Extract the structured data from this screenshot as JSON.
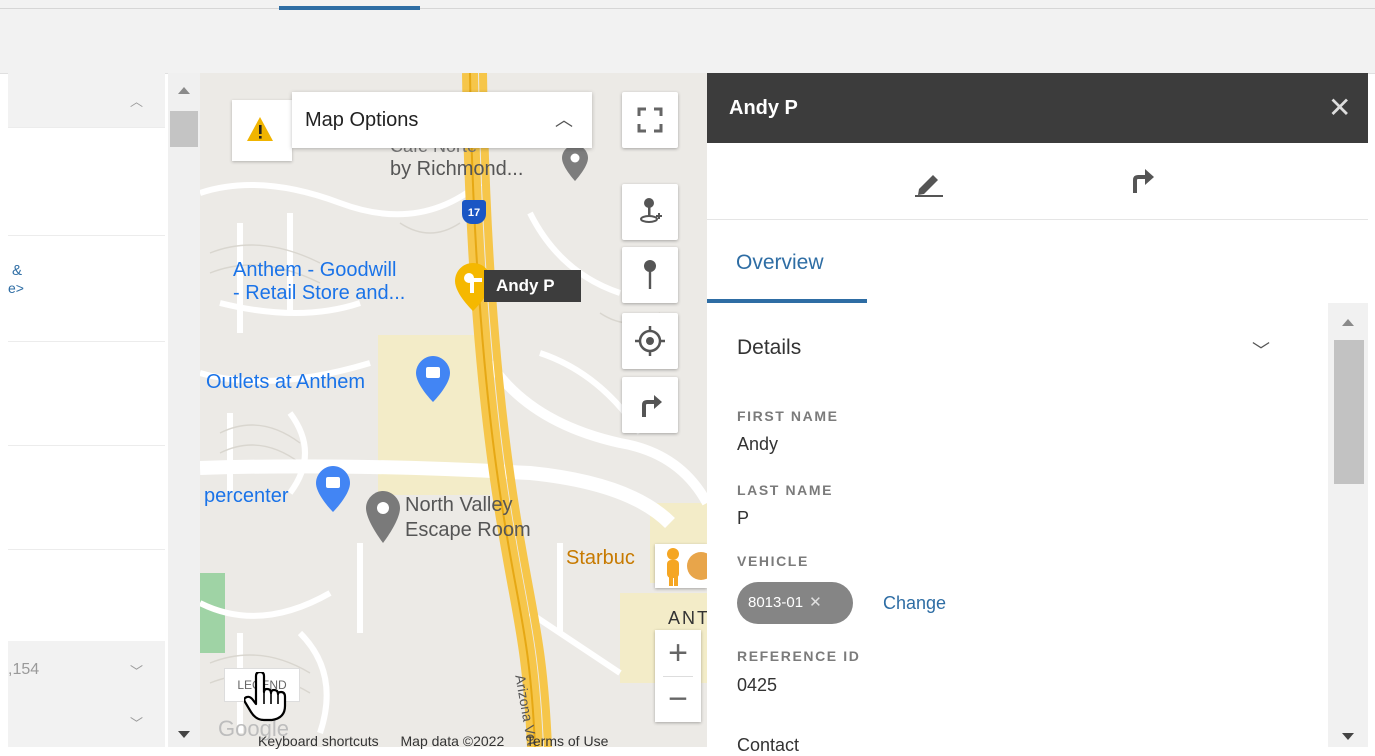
{
  "left_list": {
    "line1": "&",
    "line2": "e>",
    "footer_value": ",154"
  },
  "map": {
    "options_label": "Map Options",
    "places": {
      "cafe_partial": "Cafe Norte",
      "richmond": "by Richmond...",
      "anthem_goodwill_1": "Anthem - Goodwill",
      "anthem_goodwill_2": "- Retail Store and...",
      "outlets": "Outlets at Anthem",
      "supercenter": "percenter",
      "north_valley_1": "North Valley",
      "north_valley_2": "Escape Room",
      "starbucks": "Starbuc",
      "ant": "ANT",
      "freeway_label": "Arizona Vet",
      "highway_shield": "17"
    },
    "marker_label": "Andy P",
    "legend_label": "LEGEND",
    "attribution": {
      "google": "Google",
      "keyboard": "Keyboard shortcuts",
      "map_data": "Map data ©2022",
      "terms": "Terms of Use"
    }
  },
  "detail": {
    "title": "Andy P",
    "tab_overview": "Overview",
    "section_title": "Details",
    "fields": {
      "first_name_label": "FIRST NAME",
      "first_name_value": "Andy",
      "last_name_label": "LAST NAME",
      "last_name_value": "P",
      "vehicle_label": "VEHICLE",
      "vehicle_value": "8013-01",
      "vehicle_change": "Change",
      "reference_label": "REFERENCE ID",
      "reference_value": "0425",
      "contact_label": "Contact"
    }
  },
  "colors": {
    "accent": "#2e6da4",
    "header_dark": "#3c3c3c",
    "warning": "#f0b400"
  }
}
